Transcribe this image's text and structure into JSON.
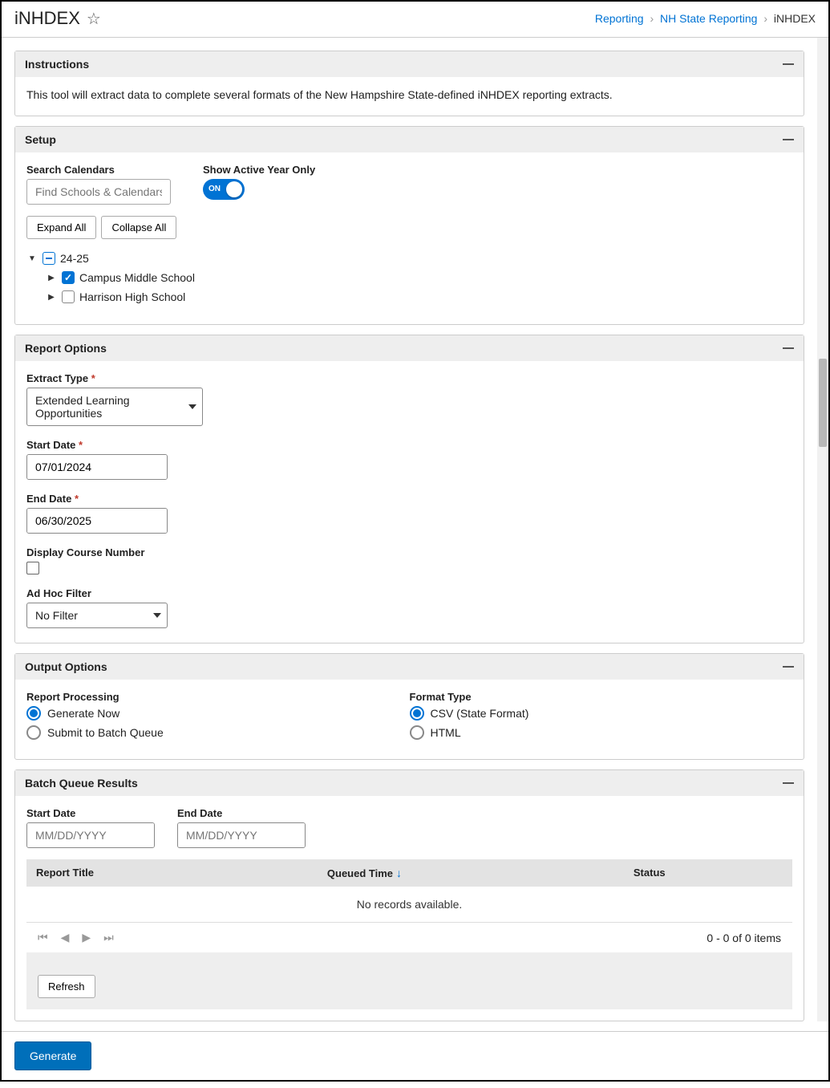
{
  "header": {
    "title": "iNHDEX",
    "breadcrumb": [
      "Reporting",
      "NH State Reporting",
      "iNHDEX"
    ]
  },
  "instructions": {
    "heading": "Instructions",
    "body": "This tool will extract data to complete several formats of the New Hampshire State-defined iNHDEX reporting extracts."
  },
  "setup": {
    "heading": "Setup",
    "search_label": "Search Calendars",
    "search_placeholder": "Find Schools & Calendars",
    "active_year_label": "Show Active Year Only",
    "toggle_text": "ON",
    "expand_all": "Expand All",
    "collapse_all": "Collapse All",
    "tree": {
      "year": "24-25",
      "schools": [
        {
          "name": "Campus Middle School",
          "checked": true
        },
        {
          "name": "Harrison High School",
          "checked": false
        }
      ]
    }
  },
  "report_options": {
    "heading": "Report Options",
    "extract_type_label": "Extract Type",
    "extract_type_value": "Extended Learning Opportunities",
    "start_date_label": "Start Date",
    "start_date_value": "07/01/2024",
    "end_date_label": "End Date",
    "end_date_value": "06/30/2025",
    "course_number_label": "Display Course Number",
    "adhoc_label": "Ad Hoc Filter",
    "adhoc_value": "No Filter"
  },
  "output_options": {
    "heading": "Output Options",
    "report_processing_label": "Report Processing",
    "processing_options": [
      "Generate Now",
      "Submit to Batch Queue"
    ],
    "format_label": "Format Type",
    "format_options": [
      "CSV  (State Format)",
      "HTML"
    ]
  },
  "batch_queue": {
    "heading": "Batch Queue Results",
    "start_date_label": "Start Date",
    "end_date_label": "End Date",
    "date_placeholder": "MM/DD/YYYY",
    "columns": {
      "title": "Report Title",
      "queued": "Queued Time",
      "status": "Status"
    },
    "empty_msg": "No records available.",
    "page_info": "0 - 0 of 0 items",
    "refresh": "Refresh"
  },
  "footer": {
    "generate": "Generate"
  }
}
